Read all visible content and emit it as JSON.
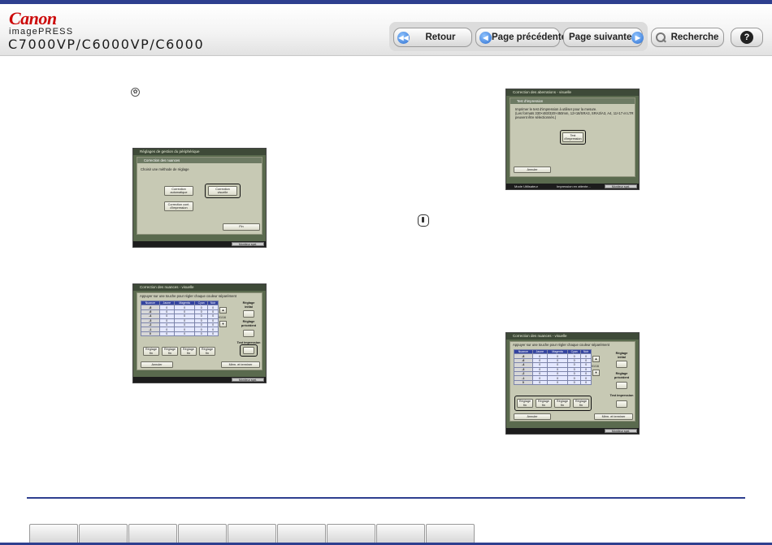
{
  "header": {
    "brand": "Canon",
    "product_line": "imagePRESS",
    "models": "C7000VP/C6000VP/C6000",
    "nav": {
      "back_label": "Retour",
      "prev_label": "Page précédente",
      "next_label": "Page suivante",
      "search_label": "Recherche",
      "help_label": "?"
    },
    "nav_icons": {
      "back": "double-left-arrow-icon",
      "prev": "left-arrow-icon",
      "next": "right-arrow-icon",
      "search": "magnifier-icon",
      "help": "question-mark-icon"
    }
  },
  "screen1": {
    "title": "Réglages de gestion du périphérique",
    "subtitle": "Correction des nuances",
    "prompt": "Choisir une méthode de réglage",
    "btn_auto": "Correction\nautomatique",
    "btn_visual": "Correction\nvisuelle",
    "btn_continuous": "Correction cont.\nd'impression",
    "btn_done": "Fin",
    "status_btn": "Moniteur syst."
  },
  "screen2": {
    "title": "Correction des nuances - visuelle",
    "prompt": "Appuyer sur une touche pour régler chaque couleur séparément",
    "headers": [
      "Nuance",
      "Jaune",
      "Magenta",
      "Cyan",
      "Noir"
    ],
    "rows": [
      [
        "-8",
        "0",
        "0",
        "0",
        "0"
      ],
      [
        "-6",
        "0",
        "0",
        "0",
        "0"
      ],
      [
        "-4",
        "0",
        "0",
        "0",
        "0"
      ],
      [
        "-3",
        "0",
        "0",
        "0",
        "0"
      ],
      [
        "-2",
        "0",
        "0",
        "0",
        "0"
      ],
      [
        "-1",
        "0",
        "0",
        "0",
        "0"
      ],
      [
        "0",
        "0",
        "0",
        "0",
        "0"
      ]
    ],
    "page_indicator": "01/16",
    "label_initial": "Réglage\ninitial",
    "label_previous": "Réglage\nprécédent",
    "label_test": "Test impression",
    "btn_fine": [
      "Réglage\nfin",
      "Réglage\nfin",
      "Réglage\nfin",
      "Réglage\nfin"
    ],
    "btn_cancel": "Annuler",
    "btn_save": "Mém. et terminer",
    "status_btn": "Moniteur syst."
  },
  "screen3": {
    "title": "Correction des aberrations - visuelle",
    "subtitle": "Test d'impression",
    "message": "Imprimer le test d'impression à utiliser pour la mesure.\n(Les formats 330×483/320×450mm, 12×18/SRA3, SRA3/A3, A4, 11×17 et LTR peuvent être sélectionnés.)",
    "btn_print": "Test\nd'impression",
    "btn_cancel": "Annuler",
    "status_mode": "Mode Utilisateur",
    "status_message": "Impression en attente...",
    "status_btn": "Moniteur syst."
  },
  "screen4": {
    "title": "Correction des nuances - visuelle",
    "prompt": "Appuyer sur une touche pour régler chaque couleur séparément",
    "headers": [
      "Nuance",
      "Jaune",
      "Magenta",
      "Cyan",
      "Noir"
    ],
    "rows": [
      [
        "-8",
        "0",
        "0",
        "0",
        "0"
      ],
      [
        "-6",
        "0",
        "0",
        "0",
        "0"
      ],
      [
        "-4",
        "0",
        "0",
        "0",
        "0"
      ],
      [
        "-3",
        "0",
        "0",
        "0",
        "0"
      ],
      [
        "-2",
        "0",
        "0",
        "0",
        "0"
      ],
      [
        "-1",
        "0",
        "0",
        "0",
        "0"
      ],
      [
        "0",
        "0",
        "0",
        "0",
        "0"
      ]
    ],
    "page_indicator": "01/16",
    "label_initial": "Réglage\ninitial",
    "label_previous": "Réglage\nprécédent",
    "label_test": "Test impression",
    "btn_fine": [
      "Réglage\nfin",
      "Réglage\nfin",
      "Réglage\nfin",
      "Réglage\nfin"
    ],
    "btn_cancel": "Annuler",
    "btn_save": "Mém. et terminer",
    "status_btn": "Moniteur syst."
  },
  "icons": {
    "note": "settings-note-icon",
    "important": "important-icon"
  },
  "footer": {
    "tab_count": 9
  },
  "colors": {
    "accent": "#2e3f8f",
    "brand_red": "#cc0a0a",
    "panel": "#c7c9b4"
  }
}
